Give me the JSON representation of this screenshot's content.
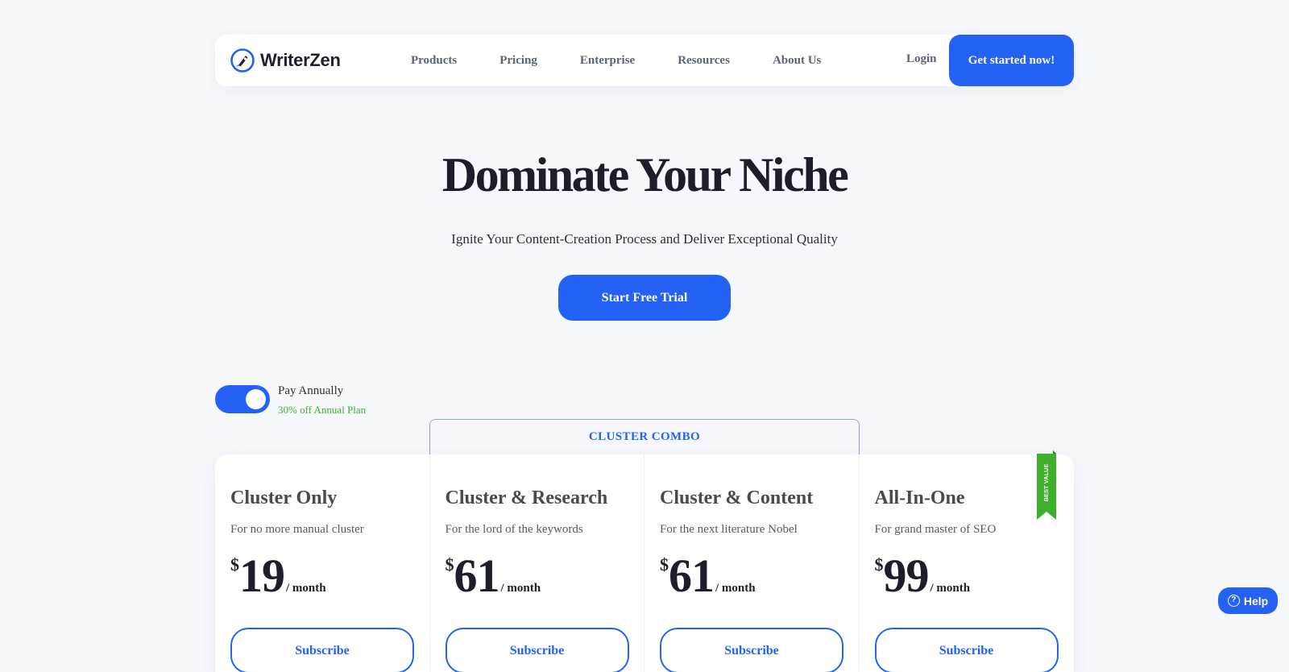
{
  "brand": {
    "name": "WriterZen",
    "logo_icon": "writerzen-logo-icon"
  },
  "nav": {
    "links": [
      "Products",
      "Pricing",
      "Enterprise",
      "Resources",
      "About Us"
    ],
    "login": "Login",
    "cta": "Get started now!"
  },
  "hero": {
    "title": "Dominate Your Niche",
    "subtitle": "Ignite Your Content-Creation Process and Deliver Exceptional Quality",
    "cta": "Start Free Trial"
  },
  "billing": {
    "label": "Pay Annually",
    "note": "30% off Annual Plan",
    "annual_enabled": true
  },
  "combo": {
    "label": "CLUSTER COMBO"
  },
  "plans": [
    {
      "name": "Cluster Only",
      "desc": "For no more manual cluster",
      "currency": "$",
      "price": "19",
      "period": "/ month",
      "button": "Subscribe"
    },
    {
      "name": "Cluster & Research",
      "desc": "For the lord of the keywords",
      "currency": "$",
      "price": "61",
      "period": "/ month",
      "button": "Subscribe"
    },
    {
      "name": "Cluster & Content",
      "desc": "For the next literature Nobel",
      "currency": "$",
      "price": "61",
      "period": "/ month",
      "button": "Subscribe"
    },
    {
      "name": "All-In-One",
      "desc": "For grand master of SEO",
      "currency": "$",
      "price": "99",
      "period": "/ month",
      "button": "Subscribe"
    }
  ],
  "ribbon": {
    "text": "BEST VALUE",
    "color": "#3fae2a"
  },
  "help": {
    "label": "Help",
    "icon": "question-circle-icon"
  },
  "colors": {
    "accent": "#2461f5",
    "success": "#3fae2a",
    "background": "#f6f8fc"
  }
}
